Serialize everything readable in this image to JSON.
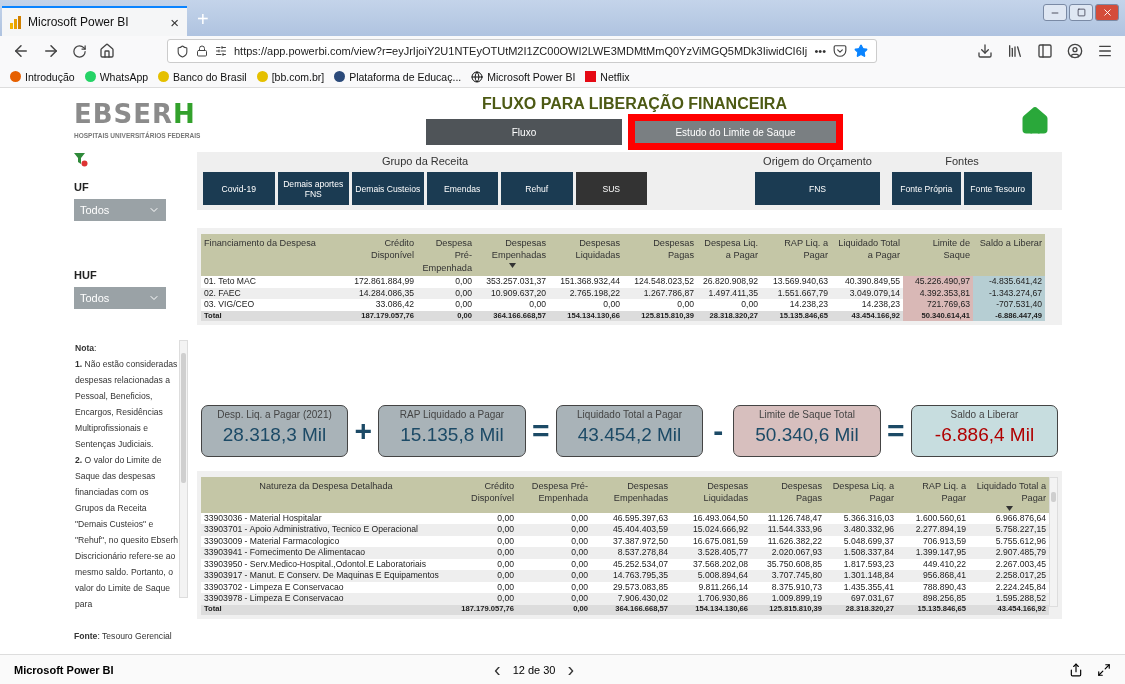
{
  "browser": {
    "tab_title": "Microsoft Power BI",
    "tab_close": "×",
    "new_tab": "+",
    "url": "https://app.powerbi.com/view?r=eyJrIjoiY2U1NTEyOTUtM2I1ZC00OWI2LWE3MDMtMmQ0YzViMGQ5MDk3IiwidCI6Ij",
    "more": "•••",
    "bookmarks": [
      {
        "label": "Introdução",
        "kind": "firefox"
      },
      {
        "label": "WhatsApp",
        "kind": "chat"
      },
      {
        "label": "Banco do Brasil",
        "kind": "bank"
      },
      {
        "label": "[bb.com.br]",
        "kind": "bank"
      },
      {
        "label": "Plataforma de Educaç...",
        "kind": "edu"
      },
      {
        "label": "Microsoft Power BI",
        "kind": "globe"
      },
      {
        "label": "Netflix",
        "kind": "netflix"
      }
    ]
  },
  "report": {
    "logo": {
      "name": "EBSER",
      "accent": "H",
      "subtitle": "HOSPITAIS UNIVERSITÁRIOS FEDERAIS"
    },
    "title": "FLUXO PARA LIBERAÇÃO FINANCEIRA",
    "pages": [
      {
        "label": "Fluxo",
        "selected": false,
        "outlined": false
      },
      {
        "label": "Estudo do Limite de Saque",
        "selected": true,
        "outlined": true
      }
    ],
    "filters": [
      {
        "label": "UF",
        "value": "Todos"
      },
      {
        "label": "HUF",
        "value": "Todos"
      }
    ],
    "slicer_groups": [
      {
        "title": "Grupo da Receita",
        "items": [
          {
            "label": "Covid-19",
            "selected": false
          },
          {
            "label": "Demais aportes FNS",
            "selected": false
          },
          {
            "label": "Demais Custeios",
            "selected": false
          },
          {
            "label": "Emendas",
            "selected": false
          },
          {
            "label": "Rehuf",
            "selected": false
          },
          {
            "label": "SUS",
            "selected": true
          }
        ]
      },
      {
        "title": "Origem do Orçamento",
        "items": [
          {
            "label": "FNS",
            "selected": false
          }
        ]
      },
      {
        "title": "Fontes",
        "items": [
          {
            "label": "Fonte Própria",
            "selected": false
          },
          {
            "label": "Fonte Tesouro",
            "selected": false
          }
        ]
      }
    ],
    "notes": [
      "**Nota**:",
      "**1.** Não estão consideradas despesas relacionadas a Pessoal, Beneficios, Encargos, Residências Multiprofissionais e Sentenças Judiciais.",
      "**2.** O valor do Limite de Saque das despesas financiadas com os Grupos da Receita \"Demais Custeios\" e \"Rehuf\", no quesito Ebserh Discricionário refere-se ao mesmo saldo. Portanto, o valor do Limite de Saque para"
    ],
    "source": "**Fonte**: Tesouro Gerencial",
    "funding_table": {
      "columns": [
        {
          "label": "Financiamento da Despesa",
          "kind": "text",
          "sorted": false
        },
        {
          "label": "Crédito Disponível",
          "kind": "number",
          "sorted": false
        },
        {
          "label": "Despesa Pré-Empenhada",
          "kind": "number",
          "sorted": false
        },
        {
          "label": "Despesas Empenhadas",
          "kind": "number",
          "sorted": true
        },
        {
          "label": "Despesas Liquidadas",
          "kind": "number",
          "sorted": false
        },
        {
          "label": "Despesas Pagas",
          "kind": "number",
          "sorted": false
        },
        {
          "label": "Despesa Liq. a Pagar",
          "kind": "number",
          "sorted": false
        },
        {
          "label": "RAP Liq. a Pagar",
          "kind": "number",
          "sorted": false
        },
        {
          "label": "Liquidado Total a Pagar",
          "kind": "number",
          "sorted": false
        },
        {
          "label": "Limite de Saque",
          "kind": "limit",
          "sorted": false
        },
        {
          "label": "Saldo a Liberar",
          "kind": "balance",
          "sorted": false
        }
      ],
      "rows": [
        [
          "01. Teto MAC",
          "172.861.884,99",
          "0,00",
          "353.257.031,37",
          "151.368.932,44",
          "124.548.023,52",
          "26.820.908,92",
          "13.569.940,63",
          "40.390.849,55",
          "45.226.490,97",
          "-4.835.641,42"
        ],
        [
          "02. FAEC",
          "14.284.086,35",
          "0,00",
          "10.909.637,20",
          "2.765.198,22",
          "1.267.786,87",
          "1.497.411,35",
          "1.551.667,79",
          "3.049.079,14",
          "4.392.353,81",
          "-1.343.274,67"
        ],
        [
          "03. VIG/CEO",
          "33.086,42",
          "0,00",
          "0,00",
          "0,00",
          "0,00",
          "0,00",
          "14.238,23",
          "14.238,23",
          "721.769,63",
          "-707.531,40"
        ]
      ],
      "total": [
        "Total",
        "187.179.057,76",
        "0,00",
        "364.166.668,57",
        "154.134.130,66",
        "125.815.810,39",
        "28.318.320,27",
        "15.135.846,65",
        "43.454.166,92",
        "50.340.614,41",
        "-6.886.447,49"
      ]
    },
    "kpis": [
      {
        "label": "Desp. Liq. a Pagar (2021)",
        "value": "28.318,3 Mil",
        "kind": "neutral",
        "operator": "+"
      },
      {
        "label": "RAP Liquidado a Pagar",
        "value": "15.135,8 Mil",
        "kind": "neutral",
        "operator": "="
      },
      {
        "label": "Liquidado Total a Pagar",
        "value": "43.454,2 Mil",
        "kind": "neutral",
        "operator": "-"
      },
      {
        "label": "Limite de Saque Total",
        "value": "50.340,6 Mil",
        "kind": "limit",
        "operator": "="
      },
      {
        "label": "Saldo a Liberar",
        "value": "-6.886,4 Mil",
        "kind": "balance"
      }
    ],
    "detail_table": {
      "columns": [
        {
          "label": "Natureza da Despesa Detalhada",
          "kind": "text",
          "sorted": false
        },
        {
          "label": "Crédito Disponível",
          "kind": "number",
          "sorted": false
        },
        {
          "label": "Despesa Pré-Empenhada",
          "kind": "number",
          "sorted": false
        },
        {
          "label": "Despesas Empenhadas",
          "kind": "number",
          "sorted": false
        },
        {
          "label": "Despesas Liquidadas",
          "kind": "number",
          "sorted": false
        },
        {
          "label": "Despesas Pagas",
          "kind": "number",
          "sorted": false
        },
        {
          "label": "Despesa Liq. a Pagar",
          "kind": "number",
          "sorted": false
        },
        {
          "label": "RAP Liq. a Pagar",
          "kind": "number",
          "sorted": false
        },
        {
          "label": "Liquidado Total a Pagar",
          "kind": "number",
          "sorted": true
        }
      ],
      "rows": [
        [
          "33903036 - Material Hospitalar",
          "0,00",
          "0,00",
          "46.595.397,63",
          "16.493.064,50",
          "11.126.748,47",
          "5.366.316,03",
          "1.600.560,61",
          "6.966.876,64"
        ],
        [
          "33903701 - Apoio Administrativo, Tecnico E Operacional",
          "0,00",
          "0,00",
          "45.404.403,59",
          "15.024.666,92",
          "11.544.333,96",
          "3.480.332,96",
          "2.277.894,19",
          "5.758.227,15"
        ],
        [
          "33903009 - Material Farmacologico",
          "0,00",
          "0,00",
          "37.387.972,50",
          "16.675.081,59",
          "11.626.382,22",
          "5.048.699,37",
          "706.913,59",
          "5.755.612,96"
        ],
        [
          "33903941 - Fornecimento De Alimentacao",
          "0,00",
          "0,00",
          "8.537.278,84",
          "3.528.405,77",
          "2.020.067,93",
          "1.508.337,84",
          "1.399.147,95",
          "2.907.485,79"
        ],
        [
          "33903950 - Serv.Medico-Hospital.,Odontol.E Laboratoriais",
          "0,00",
          "0,00",
          "45.252.534,07",
          "37.568.202,08",
          "35.750.608,85",
          "1.817.593,23",
          "449.410,22",
          "2.267.003,45"
        ],
        [
          "33903917 - Manut. E Conserv. De Maquinas E Equipamentos",
          "0,00",
          "0,00",
          "14.763.795,35",
          "5.008.894,64",
          "3.707.745,80",
          "1.301.148,84",
          "956.868,41",
          "2.258.017,25"
        ],
        [
          "33903702 - Limpeza E Conservacao",
          "0,00",
          "0,00",
          "29.573.083,85",
          "9.811.266,14",
          "8.375.910,73",
          "1.435.355,41",
          "788.890,43",
          "2.224.245,84"
        ],
        [
          "33903978 - Limpeza E Conservacao",
          "0,00",
          "0,00",
          "7.906.430,02",
          "1.706.930,86",
          "1.009.899,19",
          "697.031,67",
          "898.256,85",
          "1.595.288,52"
        ]
      ],
      "total": [
        "Total",
        "187.179.057,76",
        "0,00",
        "364.166.668,57",
        "154.134.130,66",
        "125.815.810,39",
        "28.318.320,27",
        "15.135.846,65",
        "43.454.166,92"
      ]
    }
  },
  "footer": {
    "app": "Microsoft Power BI",
    "prev": "‹",
    "page": "12 de 30",
    "next": "›"
  }
}
